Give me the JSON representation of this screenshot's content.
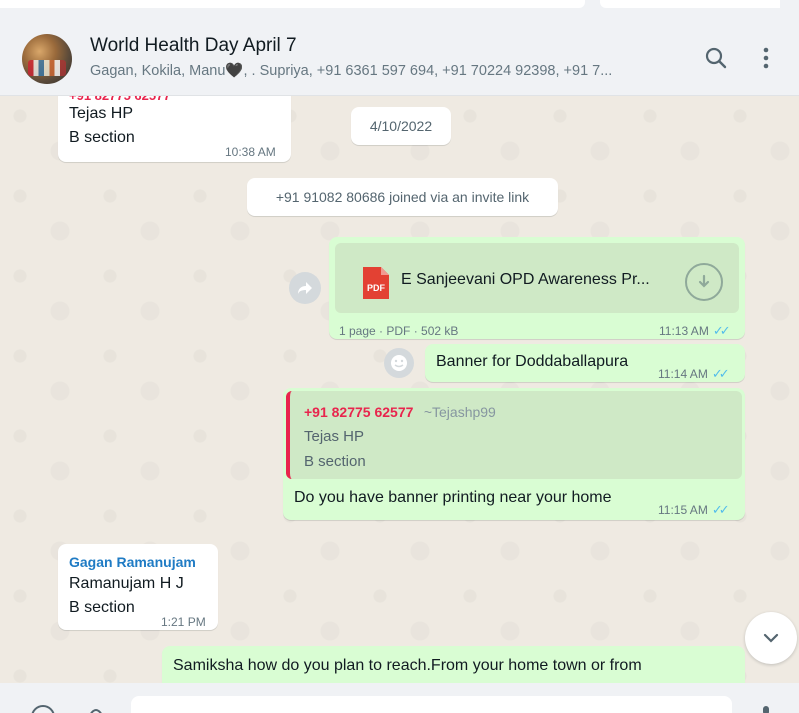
{
  "header": {
    "title": "World Health Day April 7",
    "subtitle": "Gagan, Kokila, Manu🖤, . Supriya, +91 6361 597 694, +91 70224 92398, +91 7...",
    "avatar_icon": "group-avatar-photo",
    "search_icon": "search-icon",
    "menu_icon": "more-vertical-icon"
  },
  "messages": {
    "m1": {
      "quote_top": "+91 82775 62577",
      "line1": "Tejas HP",
      "line2": "B section",
      "time": "10:38 AM"
    },
    "date_chip": "4/10/2022",
    "system_join": "+91 91082 80686 joined via an invite link",
    "doc": {
      "filename": "E Sanjeevani OPD Awareness Pr...",
      "badge": "PDF",
      "info": "1 page · PDF · 502 kB",
      "time": "11:13 AM"
    },
    "m3": {
      "text": "Banner for Doddaballapura",
      "time": "11:14 AM"
    },
    "m4": {
      "quote_sender": "+91 82775 62577",
      "quote_alias": "~Tejashp99",
      "quote_line1": "Tejas HP",
      "quote_line2": "B section",
      "text": "Do you have banner printing near your home",
      "time": "11:15 AM"
    },
    "m5": {
      "sender": "Gagan Ramanujam",
      "line1": "Ramanujam H J",
      "line2": "B section",
      "time": "1:21 PM"
    },
    "m6": {
      "text": "Samiksha how do you plan to reach.From your home town or from"
    }
  },
  "colors": {
    "outgoing": "#d9fdd3",
    "incoming": "#ffffff",
    "read_ticks": "#53bdeb",
    "sender_red": "#e8254d",
    "sender_blue": "#1f7bc4"
  }
}
